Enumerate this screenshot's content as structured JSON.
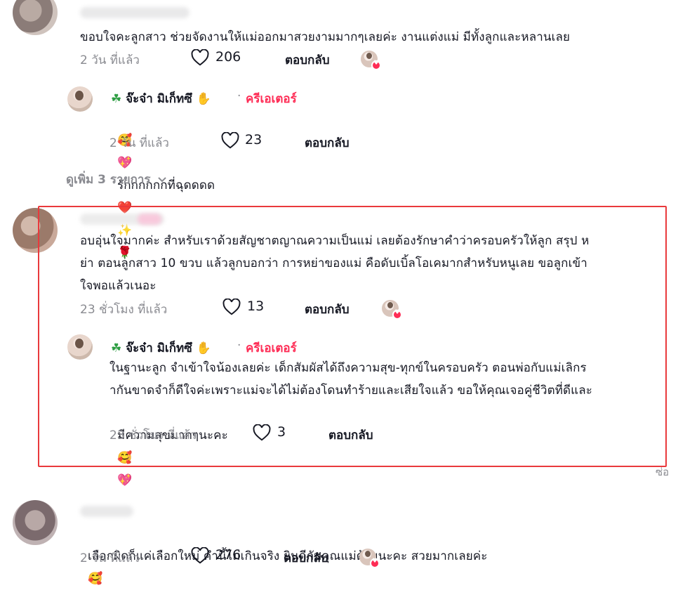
{
  "comments": [
    {
      "text": "ขอบใจคะลูกสาว ช่วยจัดงานให้แม่ออกมาสวยงามมากๆเลยค่ะ งานแต่งแม่ มีทั้งลูกและหลานเลย",
      "time": "2 วัน ที่แล้ว",
      "likes": "206",
      "reply_label": "ตอบกลับ"
    },
    {
      "text": "อบอุ่นใจมากค่ะ สำหรับเราด้วยสัญชาตญาณความเป็นแม่ เลยต้องรักษาคำว่าครอบครัวให้ลูก สรุป หย่า ตอนลูกสาว 10 ขวบ แล้วลูกบอกว่า การหย่าของแม่ คือดับเบิ้ลโอเคมากสำหรับหนูเลย ขอลูกเข้าใจพอแล้วเนอะ",
      "line1": "อบอุ่นใจมากค่ะ สำหรับเราด้วยสัญชาตญาณความเป็นแม่ เลยต้องรักษาคำว่าครอบครัวให้ลูก สรุป ห",
      "line2": "ย่า ตอนลูกสาว 10 ขวบ แล้วลูกบอกว่า การหย่าของแม่ คือดับเบิ้ลโอเคมากสำหรับหนูเลย ขอลูกเข้า",
      "line3": "ใจพอแล้วเนอะ",
      "time": "23 ชั่วโมง ที่แล้ว",
      "likes": "13",
      "reply_label": "ตอบกลับ"
    },
    {
      "text": "เลือกผิดก็แค่เลือกใหม่ คำนี้ไม่เกินจริง ยินดีกับคุณแม่ด้วยนะคะ สวยมากเลยค่ะ",
      "time": "2 วัน ที่แล้ว",
      "likes": "276",
      "reply_label": "ตอบกลับ"
    }
  ],
  "replies": [
    {
      "author": "จ๊ะจ๋า มิเก็ทซึ",
      "separator": "·",
      "creator_label": "ครีเอเตอร์",
      "text": "รักกกกกกที่ฉุดดดด",
      "time": "2 วัน ที่แล้ว",
      "likes": "23",
      "reply_label": "ตอบกลับ"
    },
    {
      "author": "จ๊ะจ๋า มิเก็ทซึ",
      "separator": "·",
      "creator_label": "ครีเอเตอร์",
      "line1": "ในฐานะลูก จำเข้าใจน้องเลยค่ะ เด็กสัมผัสได้ถึงความสุข-ทุกข์ในครอบครัว ตอนพ่อกับแม่เลิกร",
      "line2": "ากันขาดจำก็ดีใจค่ะเพราะแม่จะได้ไม่ต้องโดนทำร้ายและเสียใจแล้ว ขอให้คุณเจอคู่ชีวิตที่ดีและ",
      "line3": "มีความสุขมากๆนะคะ",
      "time": "23 ชั่วโมง ที่แล้ว",
      "likes": "3",
      "reply_label": "ตอบกลับ"
    }
  ],
  "view_more": "ดูเพิ่ม 3 รายการ",
  "side_cutoff": "ซ่อ",
  "colors": {
    "creator": "#fe2c55",
    "highlight": "#e9393c",
    "muted": "#8a8b91"
  },
  "icons": [
    "heart-icon",
    "chevron-down-icon",
    "four-leaf-clover-icon",
    "hamsa-icon"
  ]
}
